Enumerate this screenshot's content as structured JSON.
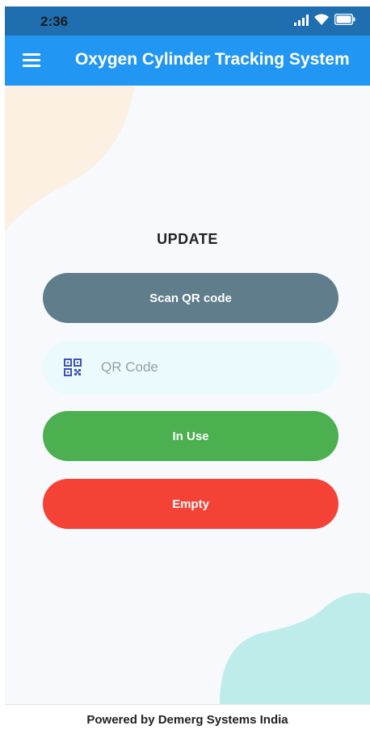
{
  "status_bar": {
    "time": "2:36",
    "icons": [
      "signal-icon",
      "wifi-icon",
      "battery-icon"
    ]
  },
  "app_bar": {
    "menu_icon": "menu-icon",
    "title": "Oxygen Cylinder Tracking System",
    "color": "#2196f3"
  },
  "main": {
    "heading": "UPDATE",
    "scan_button": {
      "label": "Scan QR code",
      "color": "#607d8b"
    },
    "qr_field": {
      "icon": "qr-code-icon",
      "placeholder": "QR Code",
      "value": ""
    },
    "in_use_button": {
      "label": "In Use",
      "color": "#4caf50"
    },
    "empty_button": {
      "label": "Empty",
      "color": "#f44336"
    }
  },
  "footer": {
    "text": "Powered by Demerg Systems India"
  }
}
